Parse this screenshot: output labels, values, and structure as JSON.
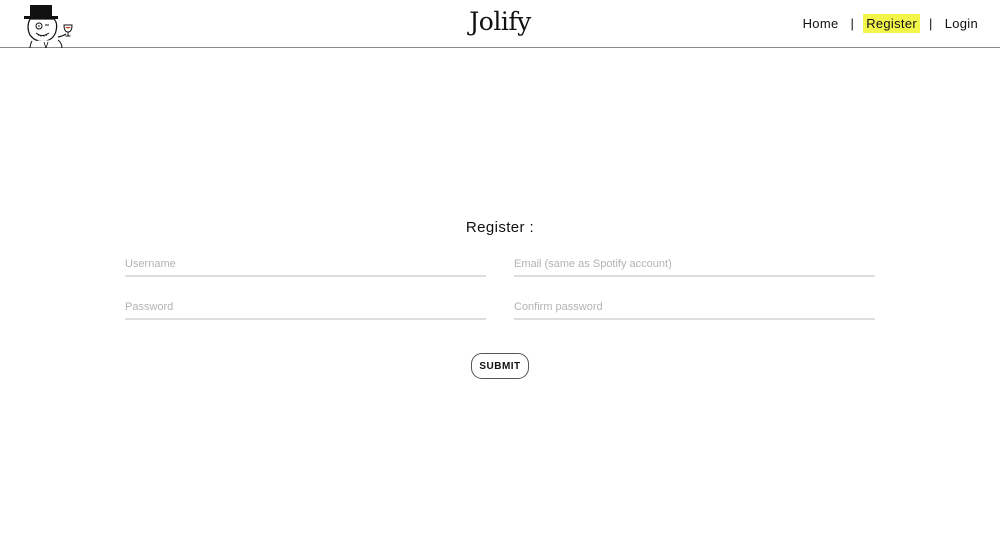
{
  "header": {
    "brand": "Jolify",
    "logo_icon": "top-hat-gentleman-icon",
    "nav": [
      {
        "label": "Home",
        "active": false
      },
      {
        "label": "Register",
        "active": true
      },
      {
        "label": "Login",
        "active": false
      }
    ],
    "separator": "|",
    "accent": "#f4f54a"
  },
  "form": {
    "title": "Register :",
    "username_placeholder": "Username",
    "email_placeholder": "Email (same as Spotify account)",
    "password_placeholder": "Password",
    "confirm_placeholder": "Confirm password",
    "submit_label": "SUBMIT"
  }
}
